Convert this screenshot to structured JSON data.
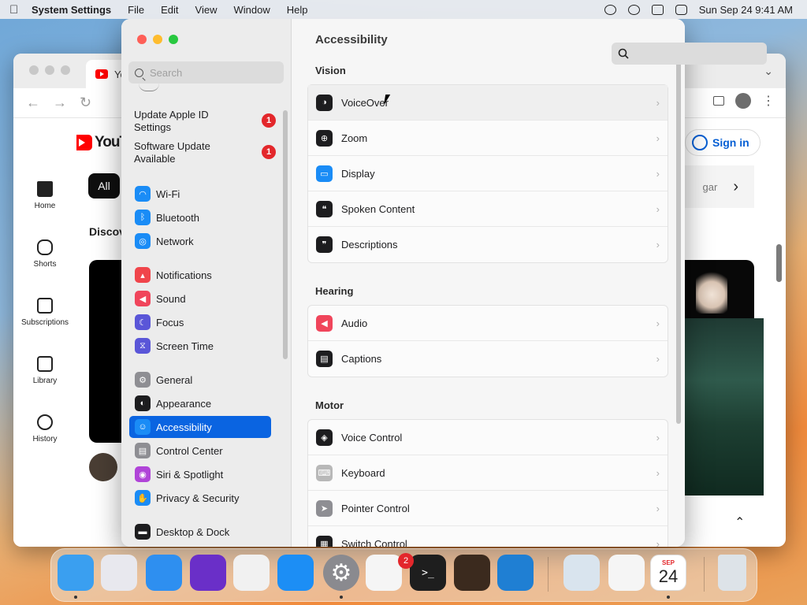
{
  "menubar": {
    "app_name": "System Settings",
    "menus": [
      "File",
      "Edit",
      "View",
      "Window",
      "Help"
    ],
    "datetime": "Sun Sep 24  9:41 AM",
    "status_icons": [
      "play-circle-icon",
      "accessibility-icon",
      "screen-mirroring-icon",
      "search-icon",
      "control-center-icon"
    ]
  },
  "browser": {
    "tab_title": "Yo",
    "yt_logo_text": "YouTube",
    "chip_all": "All",
    "discover_label": "Discov",
    "sign_in": "Sign in",
    "chip_partial": "gar",
    "sidebar": [
      {
        "label": "Home",
        "icon": "home-icon"
      },
      {
        "label": "Shorts",
        "icon": "shorts-icon"
      },
      {
        "label": "Subscriptions",
        "icon": "subscriptions-icon"
      },
      {
        "label": "Library",
        "icon": "library-icon"
      },
      {
        "label": "History",
        "icon": "history-icon"
      }
    ]
  },
  "settings": {
    "search_placeholder": "Search",
    "alerts": [
      {
        "label": "Update Apple ID Settings",
        "badge": "1"
      },
      {
        "label": "Software Update Available",
        "badge": "1"
      }
    ],
    "sidebar_items": [
      {
        "label": "Wi-Fi",
        "icon": "wifi-icon",
        "color": "#1a8cf6"
      },
      {
        "label": "Bluetooth",
        "icon": "bluetooth-icon",
        "color": "#1a8cf6"
      },
      {
        "label": "Network",
        "icon": "globe-icon",
        "color": "#1a8cf6"
      },
      {
        "label": "Notifications",
        "icon": "bell-icon",
        "color": "#f0454b"
      },
      {
        "label": "Sound",
        "icon": "speaker-icon",
        "color": "#f0455b"
      },
      {
        "label": "Focus",
        "icon": "moon-icon",
        "color": "#5a56d8"
      },
      {
        "label": "Screen Time",
        "icon": "hourglass-icon",
        "color": "#5a56d8"
      },
      {
        "label": "General",
        "icon": "gear-icon",
        "color": "#8e8e93"
      },
      {
        "label": "Appearance",
        "icon": "appearance-icon",
        "color": "#1d1d1f"
      },
      {
        "label": "Accessibility",
        "icon": "accessibility-icon",
        "color": "#1a8cf6"
      },
      {
        "label": "Control Center",
        "icon": "control-center-icon",
        "color": "#8e8e93"
      },
      {
        "label": "Siri & Spotlight",
        "icon": "siri-icon",
        "color": "#b044d8"
      },
      {
        "label": "Privacy & Security",
        "icon": "hand-icon",
        "color": "#1a8cf6"
      },
      {
        "label": "Desktop & Dock",
        "icon": "dock-icon",
        "color": "#1d1d1f"
      }
    ],
    "selected": "Accessibility",
    "page_title": "Accessibility",
    "sections": [
      {
        "title": "Vision",
        "rows": [
          {
            "label": "VoiceOver",
            "icon": "voiceover-icon",
            "color": "#1d1d1f"
          },
          {
            "label": "Zoom",
            "icon": "zoom-icon",
            "color": "#1d1d1f"
          },
          {
            "label": "Display",
            "icon": "display-icon",
            "color": "#1a8cf6"
          },
          {
            "label": "Spoken Content",
            "icon": "spoken-content-icon",
            "color": "#1d1d1f"
          },
          {
            "label": "Descriptions",
            "icon": "descriptions-icon",
            "color": "#1d1d1f"
          }
        ]
      },
      {
        "title": "Hearing",
        "rows": [
          {
            "label": "Audio",
            "icon": "speaker-icon",
            "color": "#f0455b"
          },
          {
            "label": "Captions",
            "icon": "captions-icon",
            "color": "#1d1d1f"
          }
        ]
      },
      {
        "title": "Motor",
        "rows": [
          {
            "label": "Voice Control",
            "icon": "voice-control-icon",
            "color": "#1d1d1f"
          },
          {
            "label": "Keyboard",
            "icon": "keyboard-icon",
            "color": "#b8b8b8"
          },
          {
            "label": "Pointer Control",
            "icon": "pointer-icon",
            "color": "#8e8e93"
          },
          {
            "label": "Switch Control",
            "icon": "switch-control-icon",
            "color": "#1d1d1f"
          }
        ]
      }
    ]
  },
  "dock": {
    "settings_badge": "2",
    "calendar_month": "SEP",
    "calendar_day": "24",
    "apps": [
      {
        "name": "finder-icon",
        "color": "#3a9ff0"
      },
      {
        "name": "launchpad-icon",
        "color": "#e8e8ee"
      },
      {
        "name": "safari-icon",
        "color": "#2e8ff0"
      },
      {
        "name": "firefox-icon",
        "color": "#6a2fc8"
      },
      {
        "name": "chrome-icon",
        "color": "#f1f1f1"
      },
      {
        "name": "app-store-icon",
        "color": "#1c8ef5"
      },
      {
        "name": "system-settings-icon",
        "color": "#8a8a8f"
      },
      {
        "name": "textedit-icon",
        "color": "#f5f5f5"
      },
      {
        "name": "terminal-icon",
        "color": "#1e1e1e"
      },
      {
        "name": "garageband-icon",
        "color": "#3b2a1e"
      },
      {
        "name": "vscode-icon",
        "color": "#1f7fd3"
      },
      {
        "name": "preview-icon",
        "color": "#d9e4ee"
      },
      {
        "name": "freeform-icon",
        "color": "#f5f5f5"
      },
      {
        "name": "calendar-icon",
        "color": "#ffffff"
      },
      {
        "name": "trash-icon",
        "color": "#dde3e8"
      }
    ]
  }
}
